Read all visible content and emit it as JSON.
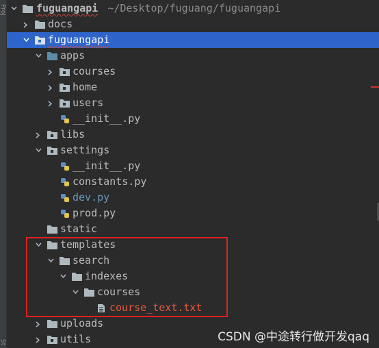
{
  "sidebar": {
    "strip_top": "Proj",
    "strip_bottom": "St"
  },
  "tree": {
    "root": {
      "name": "fuguangapi",
      "path": "~/Desktop/fuguang/fuguangapi"
    },
    "docs": "docs",
    "pkg": "fuguangapi",
    "apps": "apps",
    "courses": "courses",
    "home": "home",
    "users": "users",
    "apps_init": "__init__.py",
    "libs": "libs",
    "settings": "settings",
    "settings_init": "__init__.py",
    "constants": "constants.py",
    "dev": "dev.py",
    "prod": "prod.py",
    "static": "static",
    "templates": "templates",
    "search": "search",
    "indexes": "indexes",
    "tcourses": "courses",
    "course_text": "course_text.txt",
    "uploads": "uploads",
    "utils": "utils"
  },
  "colors": {
    "selection": "#2f65ca",
    "highlight_box": "#e02020",
    "folder": "#aeb9c0",
    "package_folder": "#5d8ca6"
  },
  "watermark": "CSDN @中途转行做开发qaq"
}
